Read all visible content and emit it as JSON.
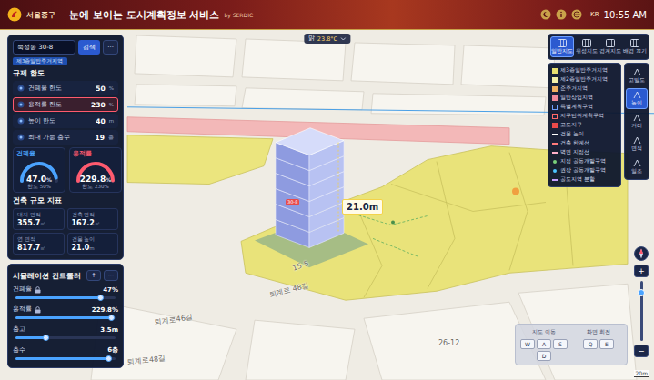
{
  "header": {
    "logo": "서울중구",
    "title": "눈에 보이는 도시계획정보 서비스",
    "subtitle": "by SERDIC",
    "lang": "KR",
    "time": "10:55 AM"
  },
  "weather": {
    "condition": "맑",
    "temp": "23.8°C"
  },
  "search": {
    "value": "묵정동 30-8",
    "button": "검색",
    "more": "···"
  },
  "zone_tag": "제3종일반주거지역",
  "limits": {
    "title": "규제 한도",
    "rows": [
      {
        "label": "건폐율 한도",
        "value": "50",
        "unit": "%",
        "selected": false
      },
      {
        "label": "용적률 한도",
        "value": "230",
        "unit": "%",
        "selected": true
      },
      {
        "label": "높이 한도",
        "value": "40",
        "unit": "m",
        "selected": false
      },
      {
        "label": "최대 가능 층수",
        "value": "19",
        "unit": "층",
        "selected": false
      }
    ]
  },
  "gauges": [
    {
      "label": "건폐율",
      "value": "47.0",
      "unit": "%",
      "limit": "한도 50%",
      "level": 0.94,
      "color": "#4aa3ff"
    },
    {
      "label": "용적률",
      "value": "229.8",
      "unit": "%",
      "limit": "한도 230%",
      "level": 0.99,
      "color": "#ff5a6e"
    }
  ],
  "metrics": {
    "title": "건축 규모 지표",
    "items": [
      {
        "label": "대지 면적",
        "value": "355.7",
        "unit": "㎡"
      },
      {
        "label": "건축 면적",
        "value": "167.2",
        "unit": "㎡"
      },
      {
        "label": "연 면적",
        "value": "817.7",
        "unit": "㎡"
      },
      {
        "label": "건물 높이",
        "value": "21.0",
        "unit": "m"
      }
    ]
  },
  "simulation": {
    "title": "시뮬레이션 컨트롤러",
    "buttons": [
      "↑",
      "···"
    ],
    "sliders": [
      {
        "label": "건폐율",
        "locked": true,
        "value": "47%",
        "level": 0.85
      },
      {
        "label": "용적률",
        "locked": true,
        "value": "229.8%",
        "level": 0.96
      },
      {
        "label": "층고",
        "locked": false,
        "value": "3.5m",
        "level": 0.3
      },
      {
        "label": "층수",
        "locked": false,
        "value": "6층",
        "level": 0.93
      }
    ]
  },
  "map_modes": [
    {
      "label": "일반지도",
      "selected": true
    },
    {
      "label": "위성지도",
      "selected": false
    },
    {
      "label": "경계지도",
      "selected": false
    },
    {
      "label": "배경 끄기",
      "selected": false
    }
  ],
  "legend": [
    {
      "label": "제3종일반주거지역",
      "kind": "fill",
      "color": "#e8e070"
    },
    {
      "label": "제2종일반주거지역",
      "kind": "fill",
      "color": "#f4f0a8"
    },
    {
      "label": "준주거지역",
      "kind": "fill",
      "color": "#f0b060"
    },
    {
      "label": "일반상업지역",
      "kind": "fill",
      "color": "#f08a9a"
    },
    {
      "label": "특별계획구역",
      "kind": "outline",
      "color": "#6fa0ff"
    },
    {
      "label": "지구단위계획구역",
      "kind": "outline",
      "color": "#ff6a6a"
    },
    {
      "label": "고도지구",
      "kind": "fill",
      "color": "#e84a4a"
    },
    {
      "label": "건물 높이",
      "kind": "line",
      "color": "#ffffff"
    },
    {
      "label": "건축 한계선",
      "kind": "line",
      "color": "#ff7b7b"
    },
    {
      "label": "벽면 지정선",
      "kind": "line",
      "color": "#ffb0c8"
    },
    {
      "label": "지정 공동개발구역",
      "kind": "dot",
      "color": "#7ad07a"
    },
    {
      "label": "권장 공동개발구역",
      "kind": "dot",
      "color": "#4cc4ff"
    },
    {
      "label": "공도지역 분할",
      "kind": "line",
      "color": "#c7a0ff"
    }
  ],
  "tools": [
    {
      "label": "고밀도",
      "selected": false
    },
    {
      "label": "높이",
      "selected": true
    },
    {
      "label": "거리",
      "selected": false
    },
    {
      "label": "면적",
      "selected": false
    },
    {
      "label": "일조",
      "selected": false
    }
  ],
  "building": {
    "floors": 6,
    "height_label": "21.0m",
    "badge": "30-8"
  },
  "map_labels": [
    "퇴계로46길",
    "퇴계로 48길",
    "퇴계로48길",
    "26-12",
    "15-5"
  ],
  "keypad": {
    "titles": [
      "지도 이동",
      "화면 회전"
    ],
    "move_keys": [
      "W",
      "A",
      "S",
      "D"
    ],
    "rotate_keys": [
      "Q",
      "E"
    ]
  },
  "zoom": {
    "in": "+",
    "out": "−",
    "level": 0.8
  },
  "scale": "20m"
}
